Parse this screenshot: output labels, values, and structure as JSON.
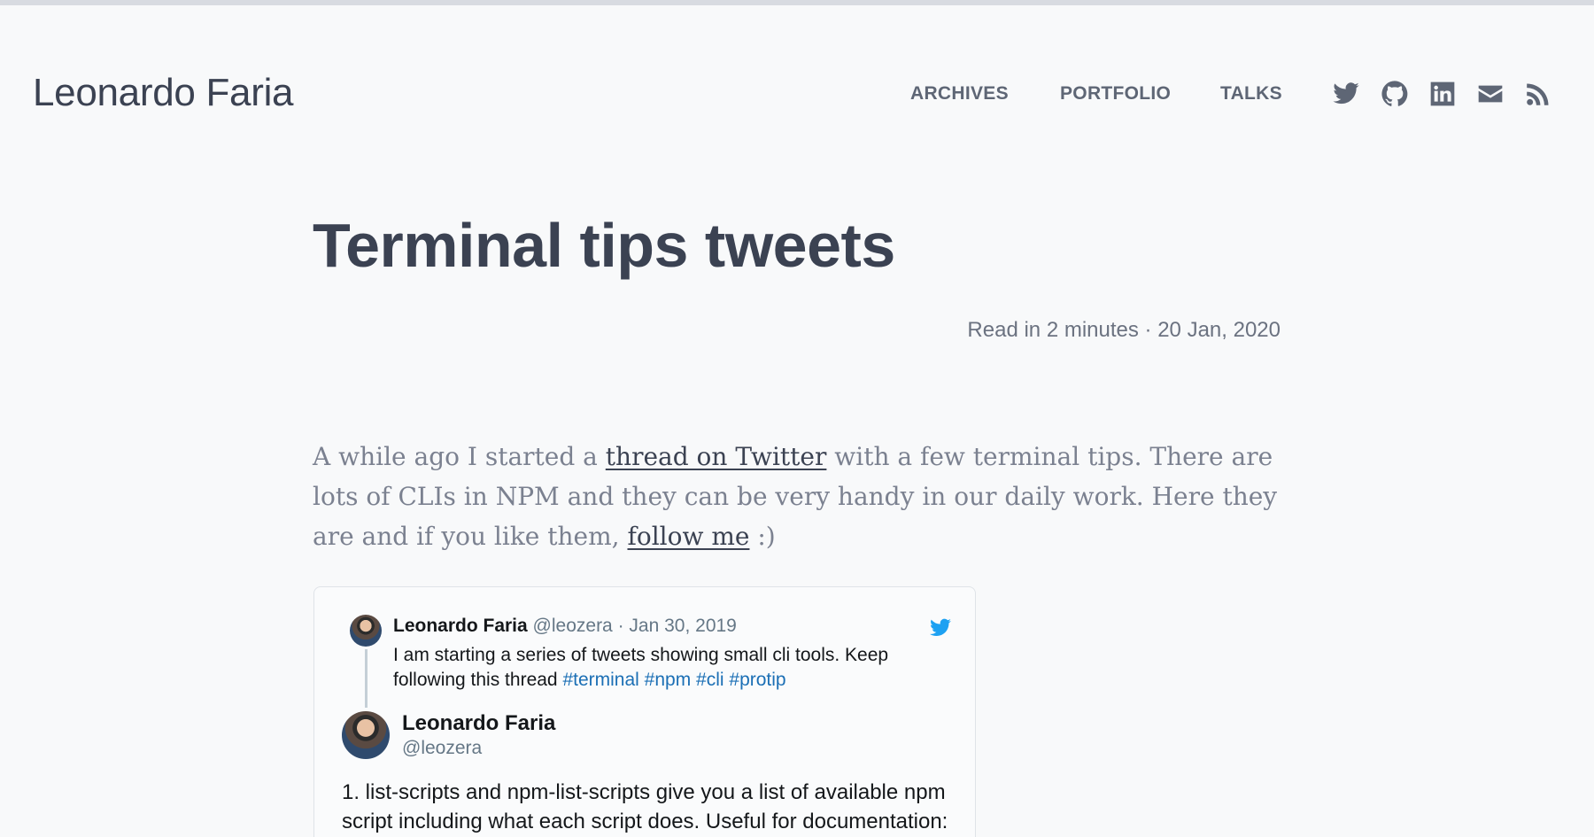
{
  "header": {
    "site_title": "Leonardo Faria",
    "nav": {
      "archives": "ARCHIVES",
      "portfolio": "PORTFOLIO",
      "talks": "TALKS"
    },
    "social_icons": [
      "twitter-icon",
      "github-icon",
      "linkedin-icon",
      "email-icon",
      "rss-icon"
    ]
  },
  "post": {
    "title": "Terminal tips tweets",
    "read_time": "Read in 2 minutes",
    "separator": " · ",
    "date": "20 Jan, 2020",
    "intro": {
      "part1": "A while ago I started a ",
      "link1": "thread on Twitter",
      "part2": " with a few terminal tips. There are lots of CLIs in NPM and they can be very handy in our daily work. Here they are and if you like them, ",
      "link2": "follow me",
      "part3": " :)"
    }
  },
  "tweet_embed": {
    "parent": {
      "name": "Leonardo Faria",
      "handle": "@leozera",
      "separator": " · ",
      "date": "Jan 30, 2019",
      "text": "I am starting a series of tweets showing small cli tools. Keep following this thread ",
      "hashtags": [
        "#terminal",
        "#npm",
        "#cli",
        "#protip"
      ]
    },
    "main": {
      "name": "Leonardo Faria",
      "handle": "@leozera",
      "text": "1. list-scripts and npm-list-scripts give you a list of available npm script including what each script does. Useful for documentation:"
    }
  },
  "colors": {
    "background": "#f8f9fa",
    "text": "#3b4252",
    "twitter_blue": "#1da1f2",
    "hashtag": "#1b6fb5"
  }
}
